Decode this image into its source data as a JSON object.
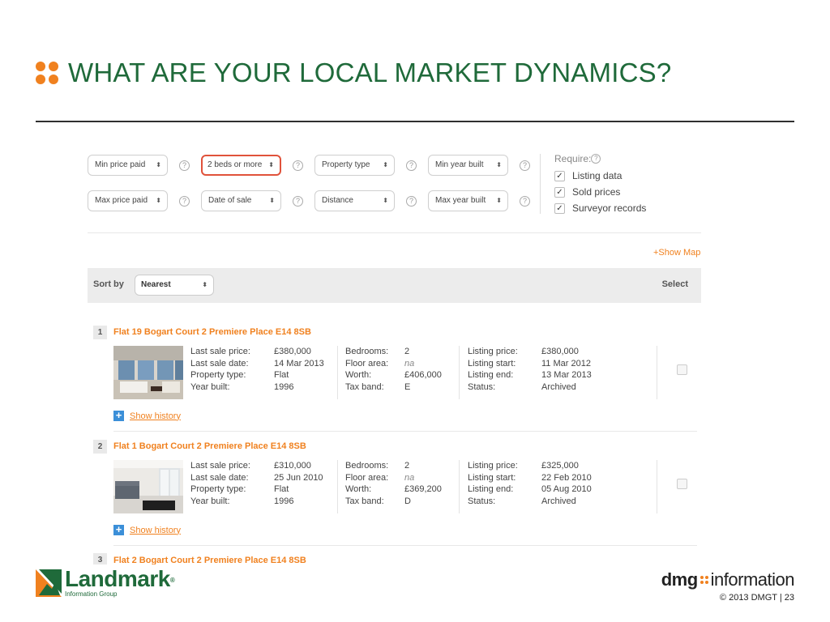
{
  "slide": {
    "title": "WHAT ARE YOUR LOCAL MARKET DYNAMICS?",
    "copyright": "© 2013 DMGT | 23"
  },
  "colors": {
    "accent_orange": "#f0811f",
    "title_green": "#1f6a3a",
    "active_border_red": "#e0523b",
    "link_blue": "#3b8fd8"
  },
  "filters": {
    "row1": [
      {
        "label": "Min price paid",
        "active": false
      },
      {
        "label": "2 beds or more",
        "active": true
      },
      {
        "label": "Property type",
        "active": false
      },
      {
        "label": "Min year built",
        "active": false
      }
    ],
    "row2": [
      {
        "label": "Max price paid",
        "active": false
      },
      {
        "label": "Date of sale",
        "active": false
      },
      {
        "label": "Distance",
        "active": false
      },
      {
        "label": "Max year built",
        "active": false
      }
    ],
    "help_glyph": "?",
    "select_arrows": "⬍"
  },
  "require": {
    "label": "Require:",
    "items": [
      {
        "label": "Listing data",
        "checked": true
      },
      {
        "label": "Sold prices",
        "checked": true
      },
      {
        "label": "Surveyor records",
        "checked": true
      }
    ]
  },
  "map_link": "+Show Map",
  "sort": {
    "label": "Sort by",
    "value": "Nearest",
    "select_label": "Select"
  },
  "field_labels": {
    "col1": [
      "Last sale price:",
      "Last sale date:",
      "Property type:",
      "Year built:"
    ],
    "col2": [
      "Bedrooms:",
      "Floor area:",
      "Worth:",
      "Tax band:"
    ],
    "col3": [
      "Listing price:",
      "Listing start:",
      "Listing end:",
      "Status:"
    ]
  },
  "results": [
    {
      "num": "1",
      "title": "Flat 19 Bogart Court 2 Premiere Place E14 8SB",
      "last_sale_price": "£380,000",
      "last_sale_date": "14 Mar 2013",
      "property_type": "Flat",
      "year_built": "1996",
      "bedrooms": "2",
      "floor_area": "na",
      "worth": "£406,000",
      "tax_band": "E",
      "listing_price": "£380,000",
      "listing_start": "11 Mar 2012",
      "listing_end": "13 Mar 2013",
      "status": "Archived",
      "history_link": "Show history"
    },
    {
      "num": "2",
      "title": "Flat 1 Bogart Court 2 Premiere Place E14 8SB",
      "last_sale_price": "£310,000",
      "last_sale_date": "25 Jun 2010",
      "property_type": "Flat",
      "year_built": "1996",
      "bedrooms": "2",
      "floor_area": "na",
      "worth": "£369,200",
      "tax_band": "D",
      "listing_price": "£325,000",
      "listing_start": "22 Feb 2010",
      "listing_end": "05 Aug 2010",
      "status": "Archived",
      "history_link": "Show history"
    }
  ],
  "partial_result": {
    "num": "3",
    "title": "Flat 2 Bogart Court 2 Premiere Place E14 8SB"
  },
  "footer": {
    "landmark_name": "Landmark",
    "landmark_reg": "®",
    "landmark_sub": "Information Group",
    "dmg_text": "dmg",
    "info_text": "information"
  }
}
